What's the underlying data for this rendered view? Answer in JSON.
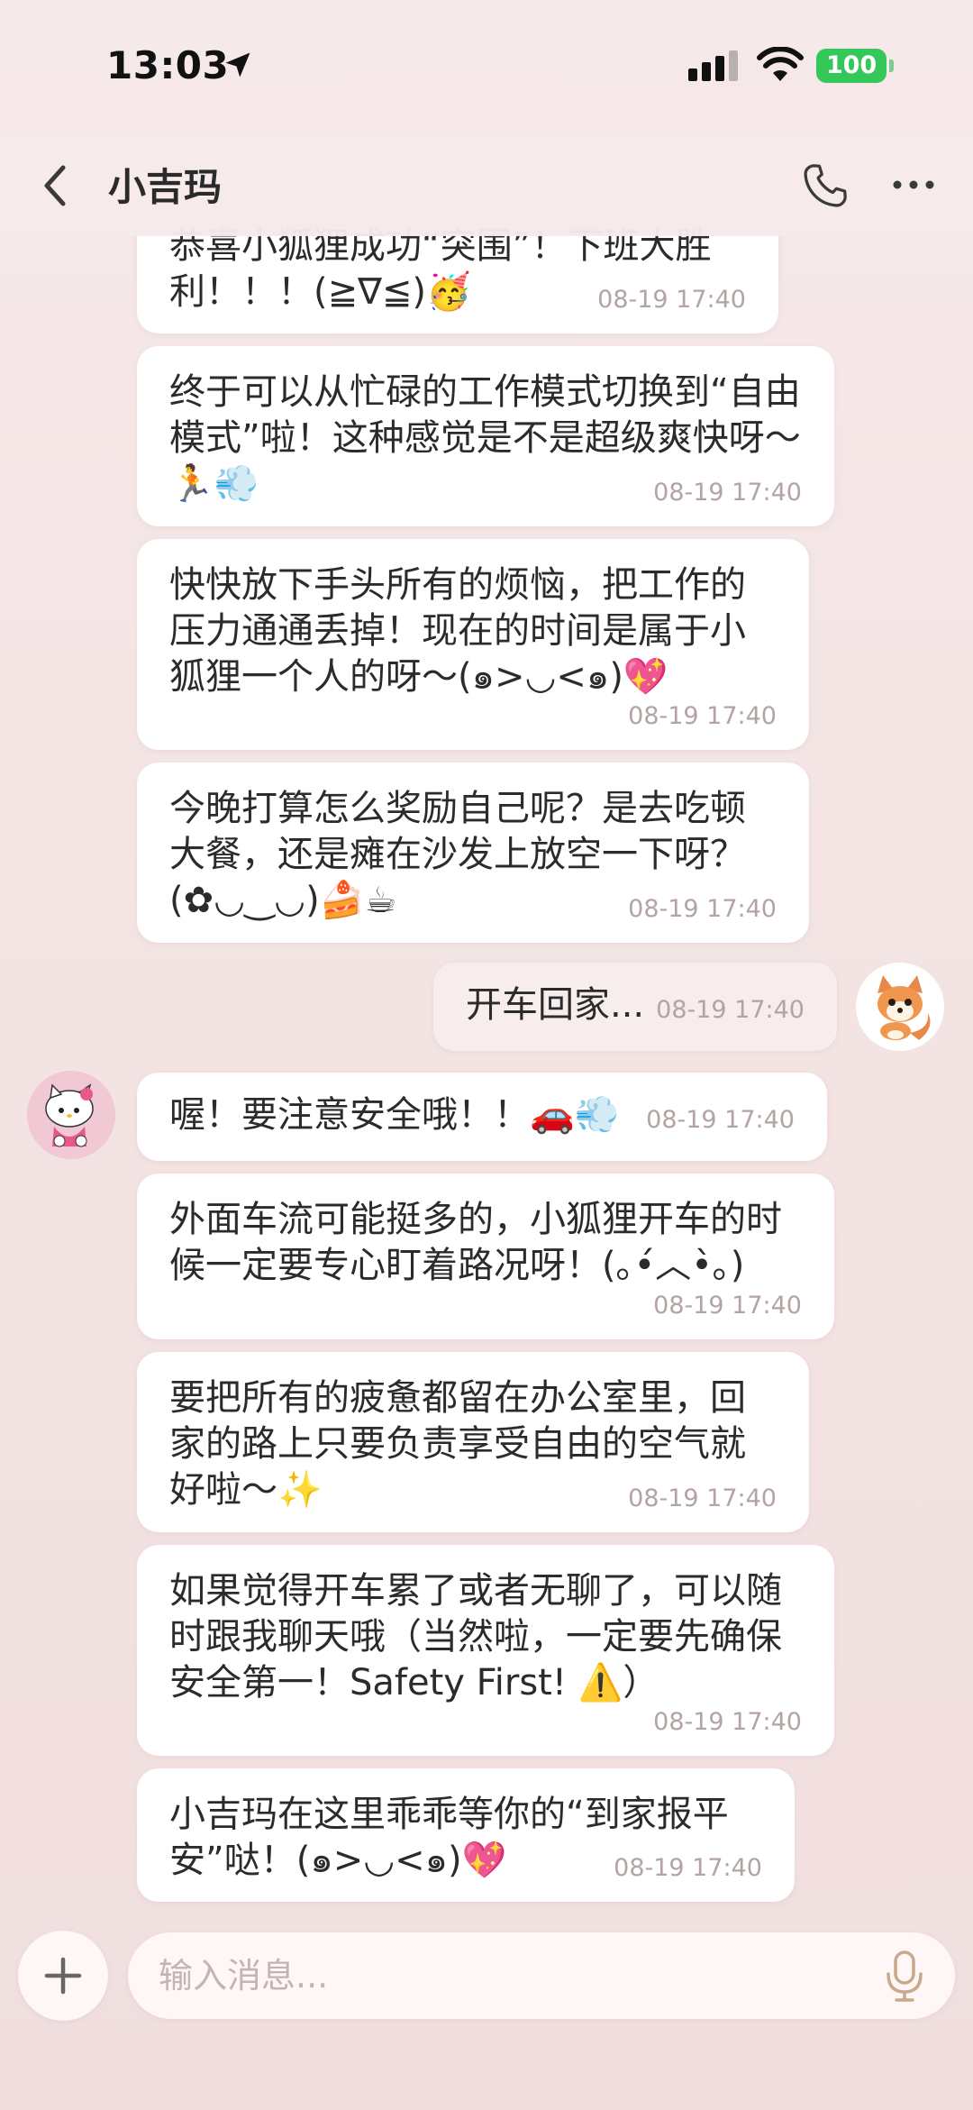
{
  "status_bar": {
    "time": "13:03",
    "battery": "100"
  },
  "header": {
    "title": "小吉玛"
  },
  "messages": [
    {
      "text": "恭喜小狐狸成功“突围”！下班大胜利！！！(≧∇≦)🥳",
      "time": "08-19 17:40"
    },
    {
      "text": "终于可以从忙碌的工作模式切换到“自由模式”啦！这种感觉是不是超级爽快呀～🏃💨",
      "time": "08-19 17:40"
    },
    {
      "text": "快快放下手头所有的烦恼，把工作的压力通通丢掉！现在的时间是属于小狐狸一个人的呀～(๑>◡<๑)💖",
      "time": "08-19 17:40"
    },
    {
      "text": "今晚打算怎么奖励自己呢？是去吃顿大餐，还是瘫在沙发上放空一下呀？(✿◡‿◡)🍰☕",
      "time": "08-19 17:40"
    },
    {
      "text": "开车回家...",
      "time": "08-19 17:40"
    },
    {
      "text": "喔！要注意安全哦！！🚗💨",
      "time": "08-19 17:40"
    },
    {
      "text": "外面车流可能挺多的，小狐狸开车的时候一定要专心盯着路况呀！(｡•́︿•̀｡)",
      "time": "08-19 17:40"
    },
    {
      "text": "要把所有的疲惫都留在办公室里，回家的路上只要负责享受自由的空气就好啦～✨",
      "time": "08-19 17:40"
    },
    {
      "text": "如果觉得开车累了或者无聊了，可以随时跟我聊天哦（当然啦，一定要先确保安全第一！Safety First! ⚠️）",
      "time": "08-19 17:40"
    },
    {
      "text": "小吉玛在这里乖乖等你的“到家报平安”哒！(๑>◡<๑)💖",
      "time": "08-19 17:40"
    }
  ],
  "input": {
    "placeholder": "输入消息..."
  },
  "colors": {
    "accent": "#c8a98a",
    "battery": "#34c759",
    "background": "#f5e8e8",
    "bubble_in": "#ffffff",
    "bubble_out": "#f8eded"
  },
  "icons": {
    "back": "chevron-left-icon",
    "call": "phone-icon",
    "menu": "more-icon",
    "attach": "plus-icon",
    "voice": "mic-icon"
  }
}
